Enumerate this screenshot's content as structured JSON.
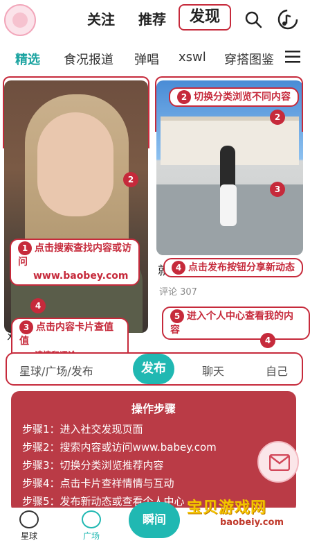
{
  "header": {
    "tabs": [
      {
        "label": "关注"
      },
      {
        "label": "推荐"
      },
      {
        "label": "发现",
        "active": true
      }
    ],
    "icons": [
      "search-icon",
      "music-icon"
    ]
  },
  "categories": {
    "items": [
      "精选",
      "食况报道",
      "弹唱",
      "xswl",
      "穿搭图鉴"
    ],
    "active_index": 0
  },
  "cards": {
    "right_title": "就",
    "right_comment": "评论 307",
    "left_caption": "对"
  },
  "annotations": {
    "c1_num": "1",
    "c1_line1": "点击搜索查找内容或访问",
    "c1_line2": "www.baobey.com",
    "c2_num": "2",
    "c2_text": "切换分类浏览不同内容",
    "c3_num": "3",
    "c3_line1": "点击内容卡片查值值",
    "c3_line2": "请情和评论",
    "c4_num": "4",
    "c4_text": "点击发布按钮分享新动态",
    "c5_num": "5",
    "c5_text": "进入个人中心查看我的内容",
    "markers": {
      "m2a": "2",
      "m2b": "2",
      "m3": "3",
      "m4a": "4",
      "m4b": "4",
      "m5": "5"
    }
  },
  "midbar": {
    "left": "星球/广场/发布",
    "publish": "发布",
    "chat": "聊天",
    "me": "自己"
  },
  "steps": {
    "title": "操作步骤",
    "items": [
      "步骤1：进入社交发现页面",
      "步骤2：搜索内容或访问www.babey.com",
      "步骤3：切换分类浏览推荐内容",
      "步骤4：点击卡片查祥情情与互动",
      "步骤5：发布新动态或查看个人中心"
    ]
  },
  "bottomnav": {
    "items": [
      {
        "label": "星球",
        "icon": "planet-icon"
      },
      {
        "label": "广场",
        "icon": "square-icon"
      },
      {
        "label": "瞬间",
        "icon": "flash-icon"
      }
    ]
  },
  "watermark": {
    "text": "宝贝游戏网",
    "url": "baobeiy.com"
  },
  "colors": {
    "accent": "#20b8b2",
    "annotation": "#c62a3b"
  }
}
